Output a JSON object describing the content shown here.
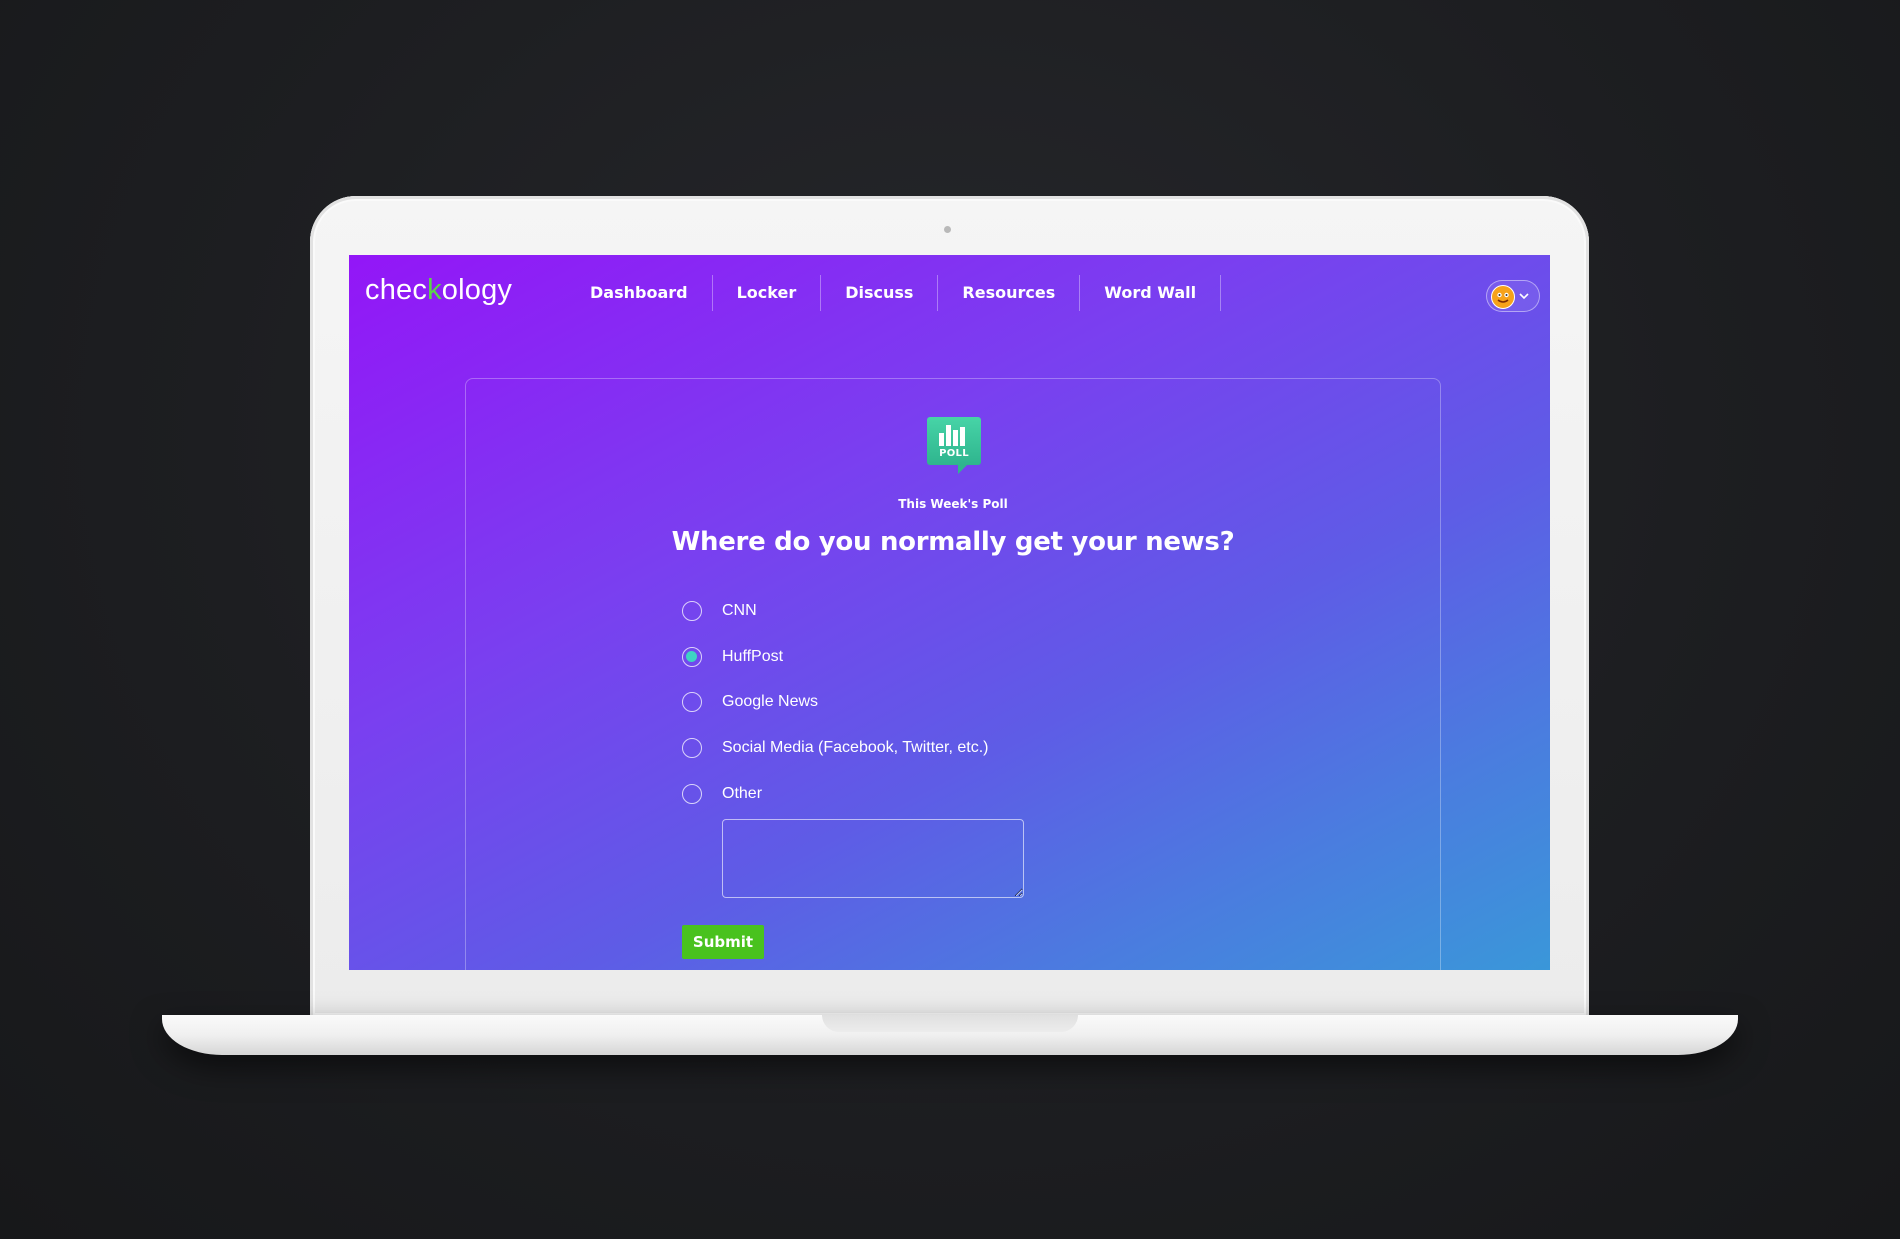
{
  "app": {
    "logo_text_start": "chec",
    "logo_text_check": "k",
    "logo_text_end": "ology",
    "accent_color": "#5cd447",
    "gradient_colors": [
      "#9316f7",
      "#5e5ce6",
      "#3a97d9"
    ]
  },
  "nav": {
    "links": [
      {
        "label": "Dashboard"
      },
      {
        "label": "Locker"
      },
      {
        "label": "Discuss"
      },
      {
        "label": "Resources"
      },
      {
        "label": "Word Wall"
      }
    ],
    "avatar_icon": "monster-avatar-icon",
    "menu_icon": "chevron-down-icon"
  },
  "poll": {
    "icon_label": "POLL",
    "icon": "bar-chart-speech-bubble-icon",
    "section_label": "This Week's Poll",
    "question": "Where do you normally get your news?",
    "options": [
      {
        "label": "CNN",
        "selected": false
      },
      {
        "label": "HuffPost",
        "selected": true
      },
      {
        "label": "Google News",
        "selected": false
      },
      {
        "label": "Social Media (Facebook, Twitter, etc.)",
        "selected": false
      },
      {
        "label": "Other",
        "selected": false
      }
    ],
    "other_input_value": "",
    "submit_label": "Submit",
    "submit_color": "#49c21e"
  }
}
